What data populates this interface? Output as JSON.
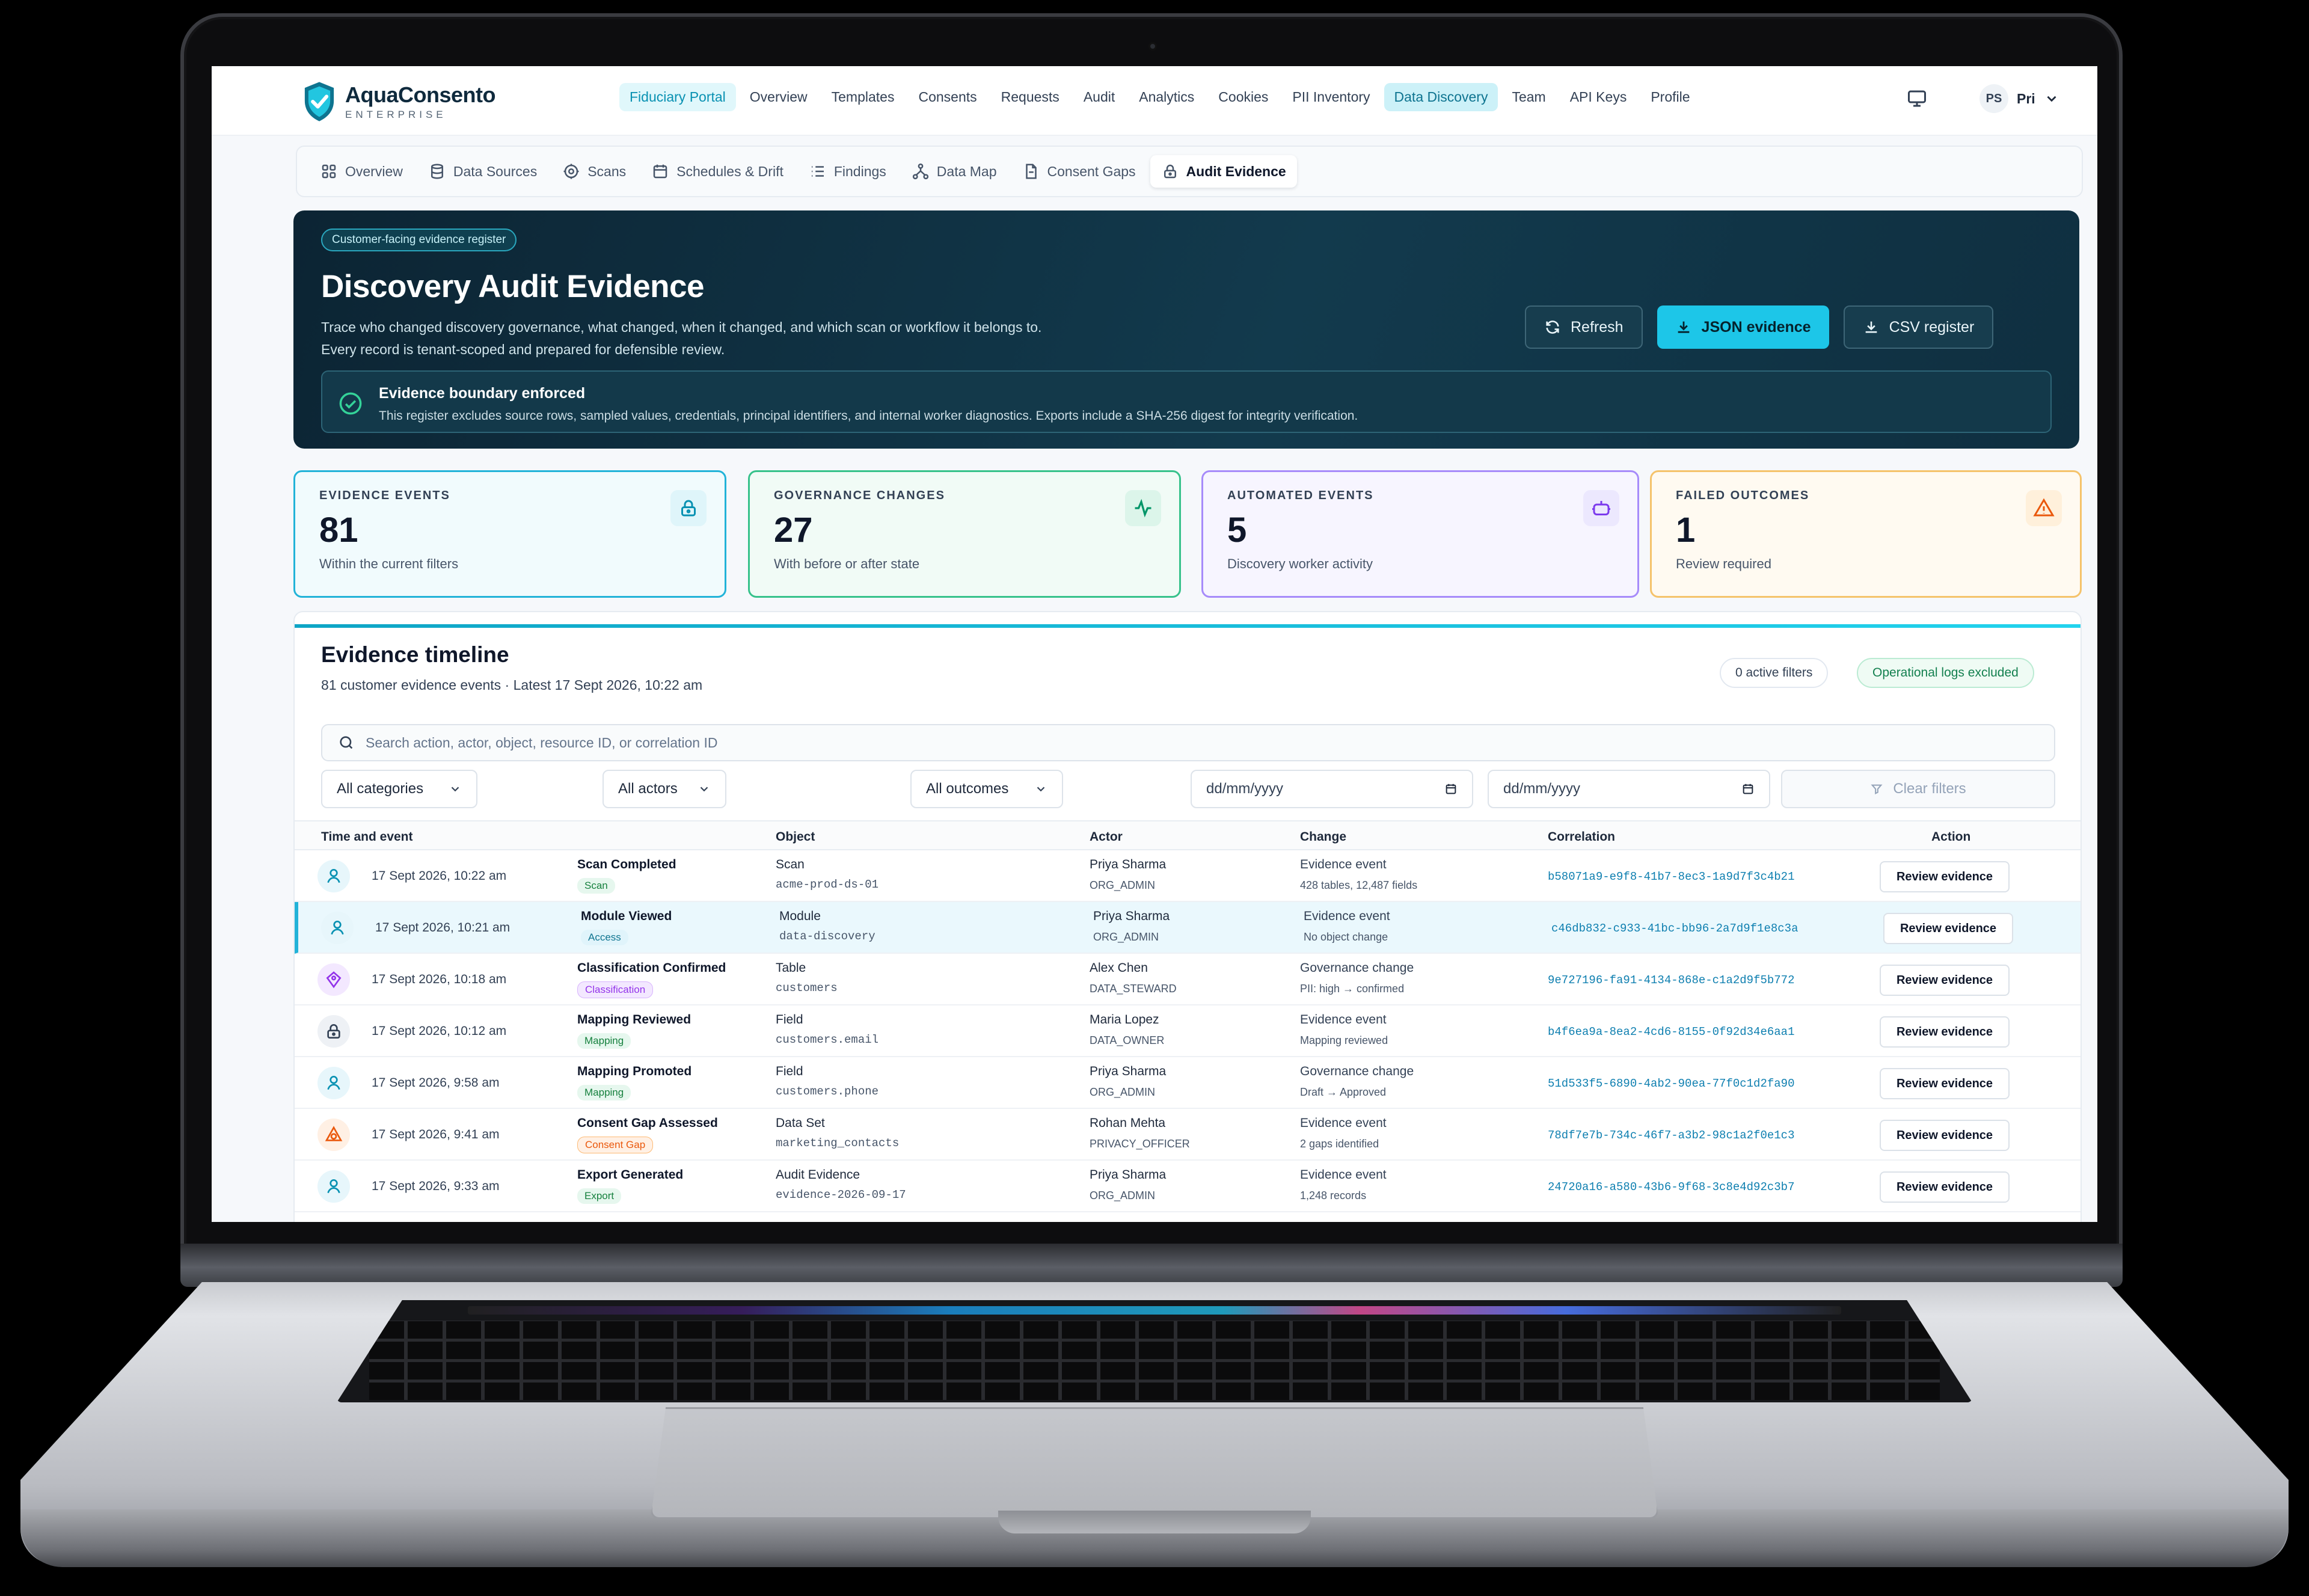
{
  "brand": {
    "name_a": "Aqua",
    "name_b": "Consento",
    "sub": "ENTERPRISE"
  },
  "topnav": {
    "items": [
      {
        "label": "Fiduciary Portal"
      },
      {
        "label": "Overview"
      },
      {
        "label": "Templates"
      },
      {
        "label": "Consents"
      },
      {
        "label": "Requests"
      },
      {
        "label": "Audit"
      },
      {
        "label": "Analytics"
      },
      {
        "label": "Cookies"
      },
      {
        "label": "PII Inventory"
      },
      {
        "label": "Data Discovery"
      },
      {
        "label": "Team"
      },
      {
        "label": "API Keys"
      },
      {
        "label": "Profile"
      }
    ],
    "active": "Data Discovery",
    "monitor_icon": "monitor-icon",
    "user_initials": "PS",
    "user_name": "Pri"
  },
  "subnav": {
    "tabs": [
      {
        "label": "Overview",
        "icon": "grid-icon"
      },
      {
        "label": "Data Sources",
        "icon": "database-icon"
      },
      {
        "label": "Scans",
        "icon": "scan-icon"
      },
      {
        "label": "Schedules & Drift",
        "icon": "calendar-icon"
      },
      {
        "label": "Findings",
        "icon": "list-icon"
      },
      {
        "label": "Data Map",
        "icon": "network-icon"
      },
      {
        "label": "Consent Gaps",
        "icon": "file-icon"
      },
      {
        "label": "Audit Evidence",
        "icon": "lock-icon"
      }
    ],
    "active": "Audit Evidence"
  },
  "hero": {
    "tag": "Customer-facing evidence register",
    "title": "Discovery Audit Evidence",
    "desc_line1": "Trace who changed discovery governance, what changed, when it changed, and which scan or workflow it belongs to.",
    "desc_line2": "Every record is tenant-scoped and prepared for defensible review.",
    "buttons": {
      "refresh": "Refresh",
      "json": "JSON evidence",
      "csv": "CSV register"
    },
    "boundary_title": "Evidence boundary enforced",
    "boundary_text": "This register excludes source rows, sampled values, credentials, principal identifiers, and internal worker diagnostics. Exports include a SHA-256 digest for integrity verification."
  },
  "stats": [
    {
      "label": "EVIDENCE EVENTS",
      "value": "81",
      "sub": "Within the current filters",
      "color": "#22b3d8",
      "icon": "lock-icon"
    },
    {
      "label": "GOVERNANCE CHANGES",
      "value": "27",
      "sub": "With before or after state",
      "color": "#37c28b",
      "icon": "activity-icon"
    },
    {
      "label": "AUTOMATED EVENTS",
      "value": "5",
      "sub": "Discovery worker activity",
      "color": "#a78bfa",
      "icon": "bot-icon"
    },
    {
      "label": "FAILED OUTCOMES",
      "value": "1",
      "sub": "Review required",
      "color": "#f5c36b",
      "icon": "warning-icon"
    }
  ],
  "timeline": {
    "title": "Evidence timeline",
    "subtitle": "81 customer evidence events · Latest 17 Sept 2026, 10:22 am",
    "chip_filters": "0 active filters",
    "chip_logs": "Operational logs excluded",
    "search_placeholder": "Search action, actor, object, resource ID, or correlation ID",
    "filters": {
      "categories": "All categories",
      "actors": "All actors",
      "outcomes": "All outcomes",
      "date_from": "dd/mm/yyyy",
      "date_to": "dd/mm/yyyy",
      "clear": "Clear filters"
    },
    "columns": [
      "Time and event",
      "Object",
      "Actor",
      "Change",
      "Correlation",
      "Action"
    ],
    "rows": [
      {
        "icon": "user-icon",
        "time": "17 Sept 2026, 10:22 am",
        "event": "Scan Completed",
        "badge": "Scan",
        "badge_color": "green",
        "object": "Scan",
        "object_id": "acme-prod-ds-01",
        "actor": "Priya Sharma",
        "role": "ORG_ADMIN",
        "change": "Evidence event",
        "change_detail": "428 tables, 12,487 fields",
        "correlation": "b58071a9-e9f8-41b7-8ec3-1a9d7f3c4b21",
        "action": "Review evidence"
      },
      {
        "icon": "user-icon",
        "time": "17 Sept 2026, 10:21 am",
        "event": "Module Viewed",
        "badge": "Access",
        "badge_color": "blue",
        "object": "Module",
        "object_id": "data-discovery",
        "actor": "Priya Sharma",
        "role": "ORG_ADMIN",
        "change": "Evidence event",
        "change_detail": "No object change",
        "correlation": "c46db832-c933-41bc-bb96-2a7d9f1e8c3a",
        "action": "Review evidence"
      },
      {
        "icon": "tag-icon",
        "time": "17 Sept 2026, 10:18 am",
        "event": "Classification Confirmed",
        "badge": "Classification",
        "badge_color": "purple",
        "object": "Table",
        "object_id": "customers",
        "actor": "Alex Chen",
        "role": "DATA_STEWARD",
        "change": "Governance change",
        "change_detail": "PII: high → confirmed",
        "correlation": "9e727196-fa91-4134-868e-c1a2d9f5b772",
        "action": "Review evidence"
      },
      {
        "icon": "lock-icon",
        "time": "17 Sept 2026, 10:12 am",
        "event": "Mapping Reviewed",
        "badge": "Mapping",
        "badge_color": "green",
        "object": "Field",
        "object_id": "customers.email",
        "actor": "Maria Lopez",
        "role": "DATA_OWNER",
        "change": "Evidence event",
        "change_detail": "Mapping reviewed",
        "correlation": "b4f6ea9a-8ea2-4cd6-8155-0f92d34e6aa1",
        "action": "Review evidence"
      },
      {
        "icon": "user-icon",
        "time": "17 Sept 2026, 9:58 am",
        "event": "Mapping Promoted",
        "badge": "Mapping",
        "badge_color": "green",
        "object": "Field",
        "object_id": "customers.phone",
        "actor": "Priya Sharma",
        "role": "ORG_ADMIN",
        "change": "Governance change",
        "change_detail": "Draft → Approved",
        "correlation": "51d533f5-6890-4ab2-90ea-77f0c1d2fa90",
        "action": "Review evidence"
      },
      {
        "icon": "alert-icon",
        "time": "17 Sept 2026, 9:41 am",
        "event": "Consent Gap Assessed",
        "badge": "Consent Gap",
        "badge_color": "orange",
        "object": "Data Set",
        "object_id": "marketing_contacts",
        "actor": "Rohan Mehta",
        "role": "PRIVACY_OFFICER",
        "change": "Evidence event",
        "change_detail": "2 gaps identified",
        "correlation": "78df7e7b-734c-46f7-a3b2-98c1a2f0e1c3",
        "action": "Review evidence"
      },
      {
        "icon": "user-icon",
        "time": "17 Sept 2026, 9:33 am",
        "event": "Export Generated",
        "badge": "Export",
        "badge_color": "green",
        "object": "Audit Evidence",
        "object_id": "evidence-2026-09-17",
        "actor": "Priya Sharma",
        "role": "ORG_ADMIN",
        "change": "Evidence event",
        "change_detail": "1,248 records",
        "correlation": "24720a16-a580-43b6-9f68-3c8e4d92c3b7",
        "action": "Review evidence"
      }
    ]
  },
  "colors": {
    "accent": "#1dc6e8",
    "hero_bg": "#0c2433",
    "badge_green": "#16a34a",
    "badge_blue": "#0891b2",
    "badge_purple": "#9333ea",
    "badge_orange": "#ea580c"
  }
}
